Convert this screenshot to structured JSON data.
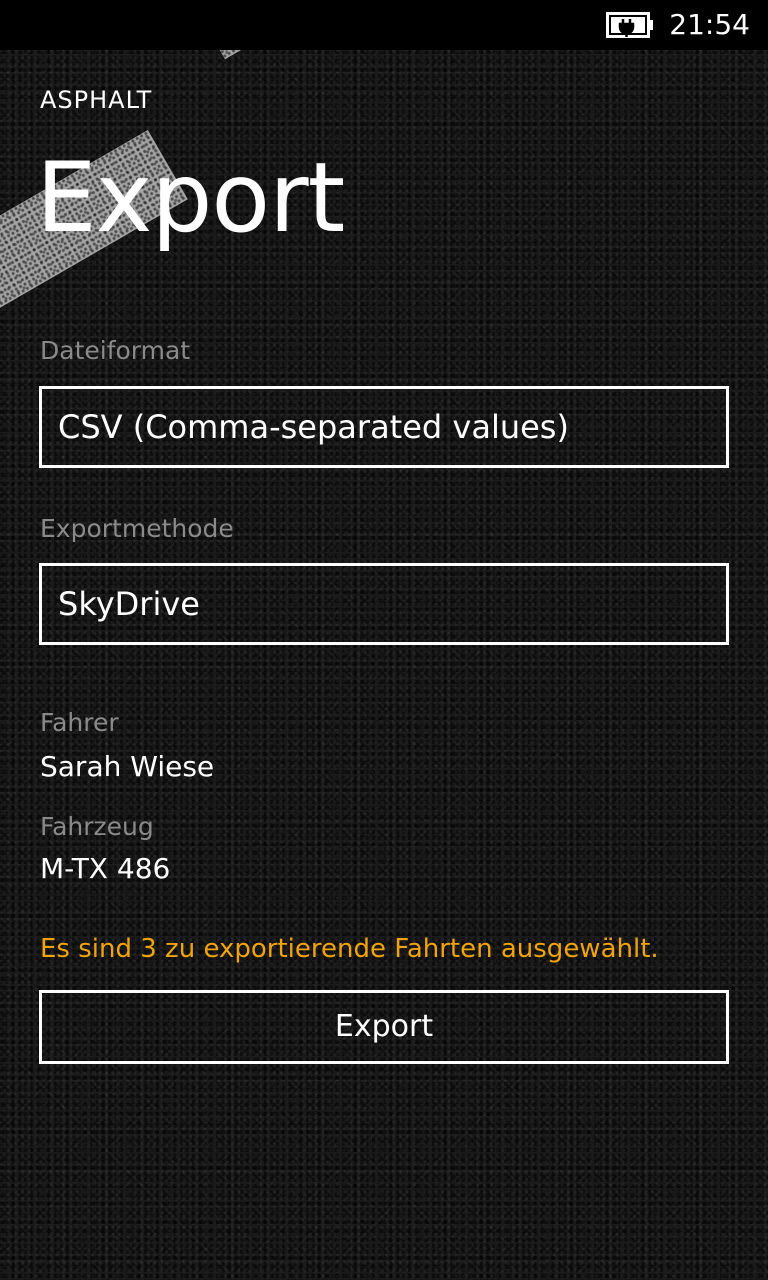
{
  "status_bar": {
    "time": "21:54",
    "battery_icon": "battery-charging-icon"
  },
  "app": {
    "name": "ASPHALT"
  },
  "page": {
    "title": "Export"
  },
  "form": {
    "file_format": {
      "label": "Dateiformat",
      "value": "CSV (Comma-separated values)"
    },
    "export_method": {
      "label": "Exportmethode",
      "value": "SkyDrive"
    },
    "driver": {
      "label": "Fahrer",
      "value": "Sarah Wiese"
    },
    "vehicle": {
      "label": "Fahrzeug",
      "value": "M-TX 486"
    }
  },
  "notice": {
    "text": "Es sind 3 zu exportierende Fahrten ausgewählt.",
    "color": "#f0a30a"
  },
  "actions": {
    "export_label": "Export"
  }
}
